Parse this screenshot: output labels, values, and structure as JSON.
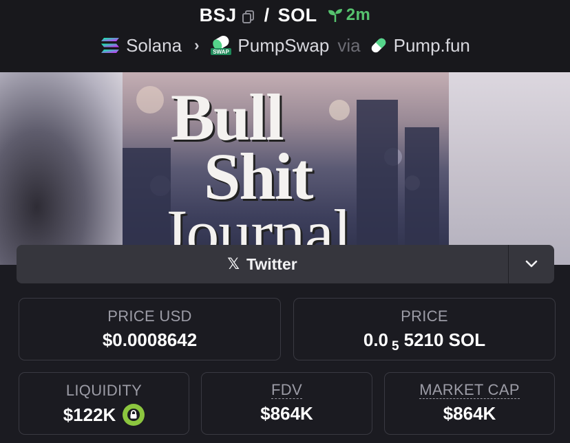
{
  "pair": {
    "base": "BSJ",
    "separator": "/",
    "quote": "SOL",
    "age": "2m"
  },
  "chain": {
    "name": "Solana",
    "dex": "PumpSwap",
    "via": "via",
    "launchpad": "Pump.fun",
    "swap_badge": "SWAP"
  },
  "banner": {
    "line1": "Bull",
    "line2": "Shit",
    "line3": "Journal"
  },
  "social": {
    "twitter_label": "Twitter"
  },
  "stats": {
    "price_usd": {
      "label": "PRICE USD",
      "value": "$0.0008642"
    },
    "price": {
      "label": "PRICE",
      "value_prefix": "0.0",
      "value_zeros": "5",
      "value_suffix": "5210 SOL"
    },
    "liquidity": {
      "label": "LIQUIDITY",
      "value": "$122K"
    },
    "fdv": {
      "label": "FDV",
      "value": "$864K"
    },
    "market_cap": {
      "label": "MARKET CAP",
      "value": "$864K"
    }
  },
  "colors": {
    "accent_green": "#56c26e",
    "lock_badge": "#8cc63f",
    "background": "#1b1b21"
  },
  "icons": [
    "copy-icon",
    "sprout-icon",
    "solana-logo-icon",
    "chevron-right-icon",
    "pumpswap-icon",
    "pill-icon",
    "x-logo-icon",
    "chevron-down-icon",
    "lock-icon"
  ]
}
